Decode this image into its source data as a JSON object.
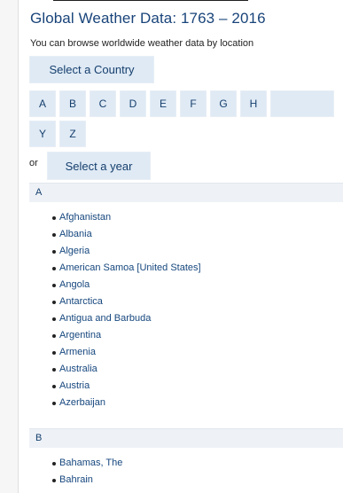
{
  "page": {
    "title": "Global Weather Data: 1763 – 2016",
    "intro": "You can browse worldwide weather data by location",
    "country_button": "Select a Country",
    "or_label": "or",
    "year_button": "Select a year"
  },
  "letters": [
    "A",
    "B",
    "C",
    "D",
    "E",
    "F",
    "G",
    "H",
    "Y",
    "Z"
  ],
  "sections": [
    {
      "letter": "A",
      "countries": [
        "Afghanistan",
        "Albania",
        "Algeria",
        "American Samoa [United States]",
        "Angola",
        "Antarctica",
        "Antigua and Barbuda",
        "Argentina",
        "Armenia",
        "Australia",
        "Austria",
        "Azerbaijan"
      ]
    },
    {
      "letter": "B",
      "countries": [
        "Bahamas, The",
        "Bahrain"
      ]
    }
  ]
}
